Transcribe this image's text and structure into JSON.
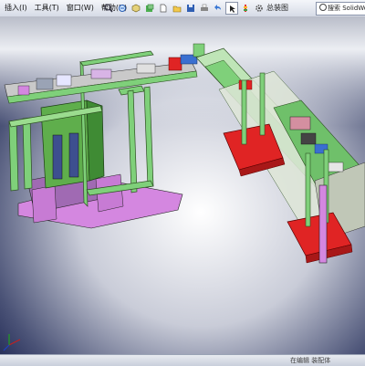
{
  "menus": [
    "插入(I)",
    "工具(T)",
    "窗口(W)",
    "帮助(H)"
  ],
  "toolbar_icons": [
    "search-icon",
    "zoom-icon",
    "view-orientation-icon",
    "display-style-icon",
    "new-document-icon",
    "open-icon",
    "save-icon",
    "print-icon",
    "undo-icon",
    "select-icon",
    "rebuild-icon",
    "options-icon"
  ],
  "document_title": "总装图",
  "search": {
    "label": "搜索 SolidWorks"
  },
  "status": {
    "text": "在编辑 装配体"
  },
  "colors": {
    "frame_green": "#7fd07a",
    "frame_purple": "#d487e0",
    "cabinet_green": "#5fae4c",
    "cylinder_red": "#e02424",
    "blue_frame": "#3a6fd0"
  }
}
